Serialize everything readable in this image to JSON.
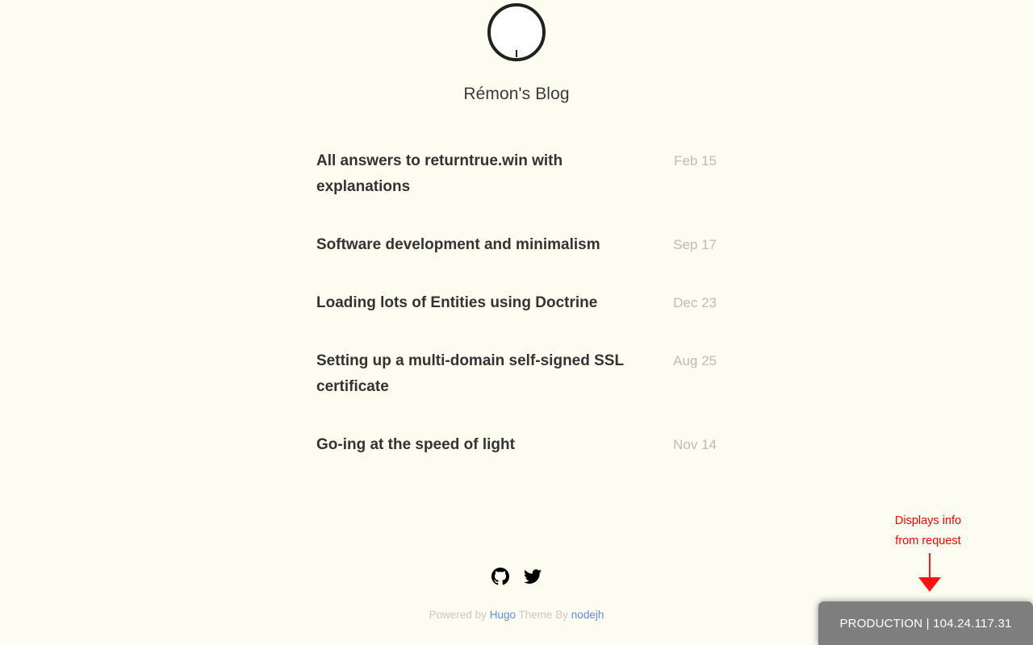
{
  "site": {
    "title": "Rémon's Blog",
    "logo_icon": "circle-avatar-icon"
  },
  "posts": [
    {
      "title": "All answers to returntrue.win with explanations",
      "date": "Feb 15"
    },
    {
      "title": "Software development and minimalism",
      "date": "Sep 17"
    },
    {
      "title": "Loading lots of Entities using Doctrine",
      "date": "Dec 23"
    },
    {
      "title": "Setting up a multi-domain self-signed SSL certificate",
      "date": "Aug 25"
    },
    {
      "title": "Go-ing at the speed of light",
      "date": "Nov 14"
    }
  ],
  "footer": {
    "social": [
      {
        "icon": "github-icon"
      },
      {
        "icon": "twitter-icon"
      }
    ],
    "credits": {
      "powered_by": "Powered by",
      "engine": "Hugo",
      "theme_by": "Theme By",
      "theme_author": "nodejh"
    }
  },
  "annotation": {
    "line1": "Displays info",
    "line2": "from request",
    "color": "#ff0000",
    "arrow_icon": "down-arrow-icon"
  },
  "env_badge": {
    "text": "PRODUCTION | 104.24.117.31",
    "background": "#7e7e7e",
    "text_color": "#ffffff"
  },
  "theme": {
    "page_background": "#fdfcf1",
    "title_color": "#333333",
    "date_color": "#bdbdb6",
    "link_color": "#5b8def"
  }
}
